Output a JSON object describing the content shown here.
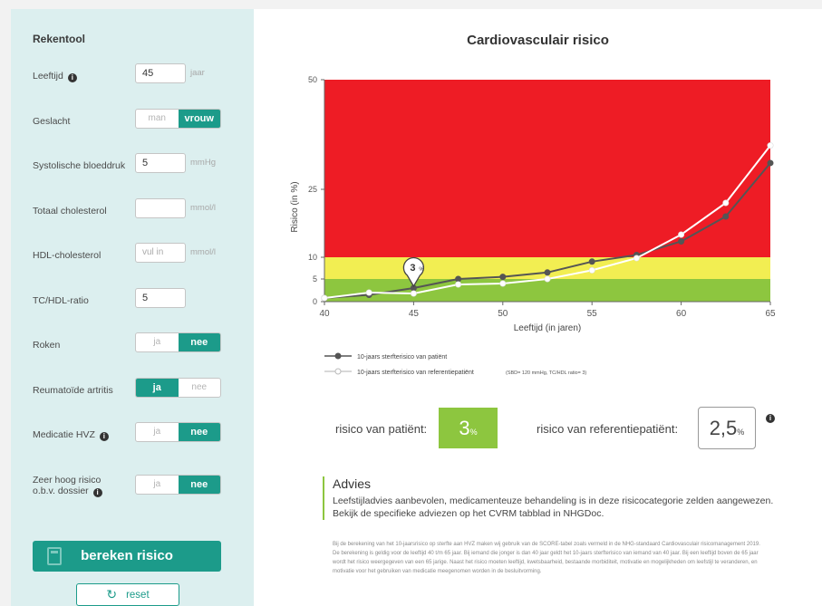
{
  "sidebar": {
    "title": "Rekentool",
    "leeftijd": {
      "label": "Leeftijd",
      "value": "45",
      "unit": "jaar"
    },
    "geslacht": {
      "label": "Geslacht",
      "opt1": "man",
      "opt2": "vrouw",
      "selected": "vrouw"
    },
    "systolisch": {
      "label": "Systolische bloeddruk",
      "value": "5",
      "unit": "mmHg"
    },
    "totaal_chol": {
      "label": "Totaal cholesterol",
      "value": "",
      "unit": "mmol/l"
    },
    "hdl": {
      "label": "HDL-cholesterol",
      "placeholder": "vul in",
      "unit": "mmol/l"
    },
    "ratio": {
      "label": "TC/HDL-ratio",
      "value": "5"
    },
    "roken": {
      "label": "Roken",
      "opt1": "ja",
      "opt2": "nee",
      "selected": "nee"
    },
    "reuma": {
      "label": "Reumatoïde artritis",
      "opt1": "ja",
      "opt2": "nee",
      "selected": "ja"
    },
    "medicatie": {
      "label": "Medicatie HVZ",
      "opt1": "ja",
      "opt2": "nee",
      "selected": "nee"
    },
    "zeer_hoog": {
      "label_line1": "Zeer hoog risico",
      "label_line2": "o.b.v. dossier",
      "opt1": "ja",
      "opt2": "nee",
      "selected": "nee"
    },
    "calc_button": "bereken risico",
    "reset_button": "reset",
    "info_glyph": "i"
  },
  "main": {
    "title": "Cardiovasculair risico",
    "marker_label": "3",
    "marker_unit": "%",
    "risico_patient_label": "risico van patiënt:",
    "risico_patient_value": "3",
    "risico_patient_unit": "%",
    "risico_ref_label": "risico van referentiepatiënt:",
    "risico_ref_value": "2,5",
    "risico_ref_unit": "%",
    "advies_title": "Advies",
    "advies_text": "Leefstijladvies aanbevolen, medicamenteuze behandeling is in deze risicocategorie zelden aangewezen. Bekijk de specifieke adviezen op het CVRM tabblad in NHGDoc.",
    "footnote": "Bij de berekening van het 10-jaarsrisico op sterfte aan HVZ maken wij gebruik van de SCORE-tabel zoals vermeld in de NHG-standaard Cardiovasculair risicomanagement 2019. De berekening is geldig voor de leeftijd 40 t/m 65 jaar. Bij iemand die jonger is dan 40 jaar geldt het 10-jaars sterfterisico van iemand van 40 jaar. Bij een leeftijd boven de 65 jaar wordt het risico weergegeven van een 65 jarige. Naast het risico moeten leeftijd, kwetsbaarheid, bestaande morbiditeit, motivatie en mogelijkheden om leefstijl te veranderen, en motivatie voor het gebruiken van medicatie meegenomen worden in de besluitvorming."
  },
  "chart_data": {
    "type": "line",
    "title": "",
    "xlabel": "Leeftijd (in jaren)",
    "ylabel": "Risico (in %)",
    "xlim": [
      40,
      65
    ],
    "ylim": [
      0,
      50
    ],
    "x_ticks": [
      "40",
      "45",
      "50",
      "55",
      "60",
      "65"
    ],
    "y_ticks": [
      "0",
      "5",
      "10",
      "25",
      "50"
    ],
    "bands": [
      {
        "from": 0,
        "to": 2.5,
        "color": "#8dc63f"
      },
      {
        "from": 2.5,
        "to": 5,
        "color": "#8dc63f"
      },
      {
        "from": 5,
        "to": 10,
        "color": "#f2ee52"
      },
      {
        "from": 10,
        "to": 50,
        "color": "#ee1c25"
      }
    ],
    "x": [
      40,
      42.5,
      45,
      47.5,
      50,
      52.5,
      55,
      57.5,
      60,
      62.5,
      65
    ],
    "series": [
      {
        "name": "10-jaars sterfterisico van patiënt",
        "color": "#555555",
        "values": [
          0.8,
          1.5,
          3,
          5,
          5.5,
          6.5,
          9,
          10.5,
          13.5,
          19,
          31
        ]
      },
      {
        "name": "10-jaars sterfterisico van referentiepatiënt",
        "note": "(SBD= 120 mmHg, TC/HDL ratio= 3)",
        "color": "#ffffff",
        "values": [
          0.8,
          2,
          1.8,
          3.8,
          4,
          5,
          7,
          9.8,
          15,
          22,
          35
        ]
      }
    ],
    "marker": {
      "x": 45,
      "y": 3
    }
  }
}
